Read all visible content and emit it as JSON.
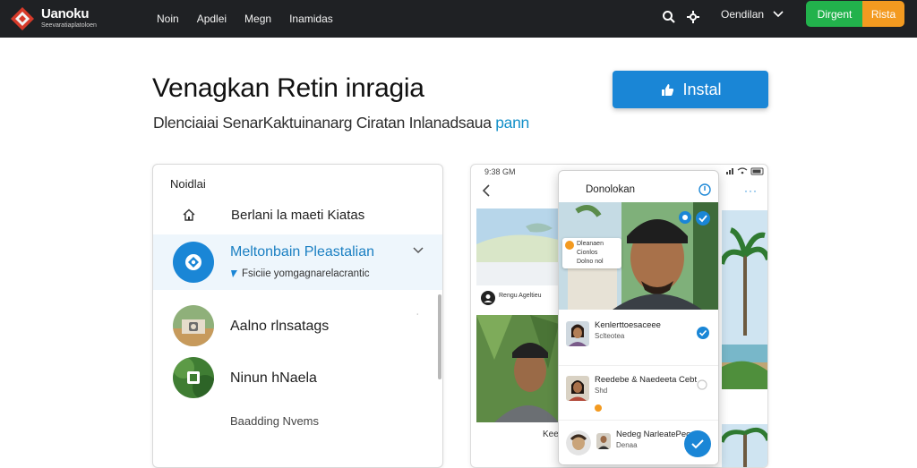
{
  "brand": {
    "name": "Uanoku",
    "tagline": "Seevaratiaplatoloen"
  },
  "nav": [
    "Noin",
    "Apdlei",
    "Megn",
    "Inamidas"
  ],
  "language": "Oendilan",
  "buttons": {
    "primary": "Dirgent",
    "secondary": "Rista"
  },
  "hero": {
    "title": "Venagkan Retin inragia",
    "subtitle": "Dlenciaiai SenarKaktuinanarg Ciratan Inlanadsaua",
    "subtitle_accent": "pann",
    "install_label": "Instal"
  },
  "panel": {
    "title": "Noidlai",
    "home_label": "Berlani la maeti Kiatas",
    "selected": {
      "label": "Meltonbain Pleastalian",
      "sub": "Fsiciie yomgagnarelacrantic"
    },
    "items": [
      {
        "label": "Aalno rlnsatags"
      },
      {
        "label": "Ninun hNaela"
      }
    ],
    "footer_label": "Baadding Nvems"
  },
  "phone": {
    "status_time": "9:38 GM",
    "header": "Donolokan",
    "caption_left": "Rengu  Ageltieu",
    "caption_bottom": "Kee",
    "card_lines": [
      "Dleanaen",
      "Cionlos",
      "Dolno nol"
    ],
    "contacts": [
      {
        "name": "Kenlerttoesaceee",
        "sub": "Sclteotea"
      },
      {
        "name": "Reedebe & Naedeeta Cebt",
        "sub": "Shd"
      },
      {
        "name": "Nedeg NarleatePeo",
        "sub": "Denaa"
      }
    ]
  },
  "colors": {
    "topbar": "#1f2124",
    "accent_blue": "#1a86d6",
    "green": "#22b24c",
    "orange": "#f39a20"
  }
}
